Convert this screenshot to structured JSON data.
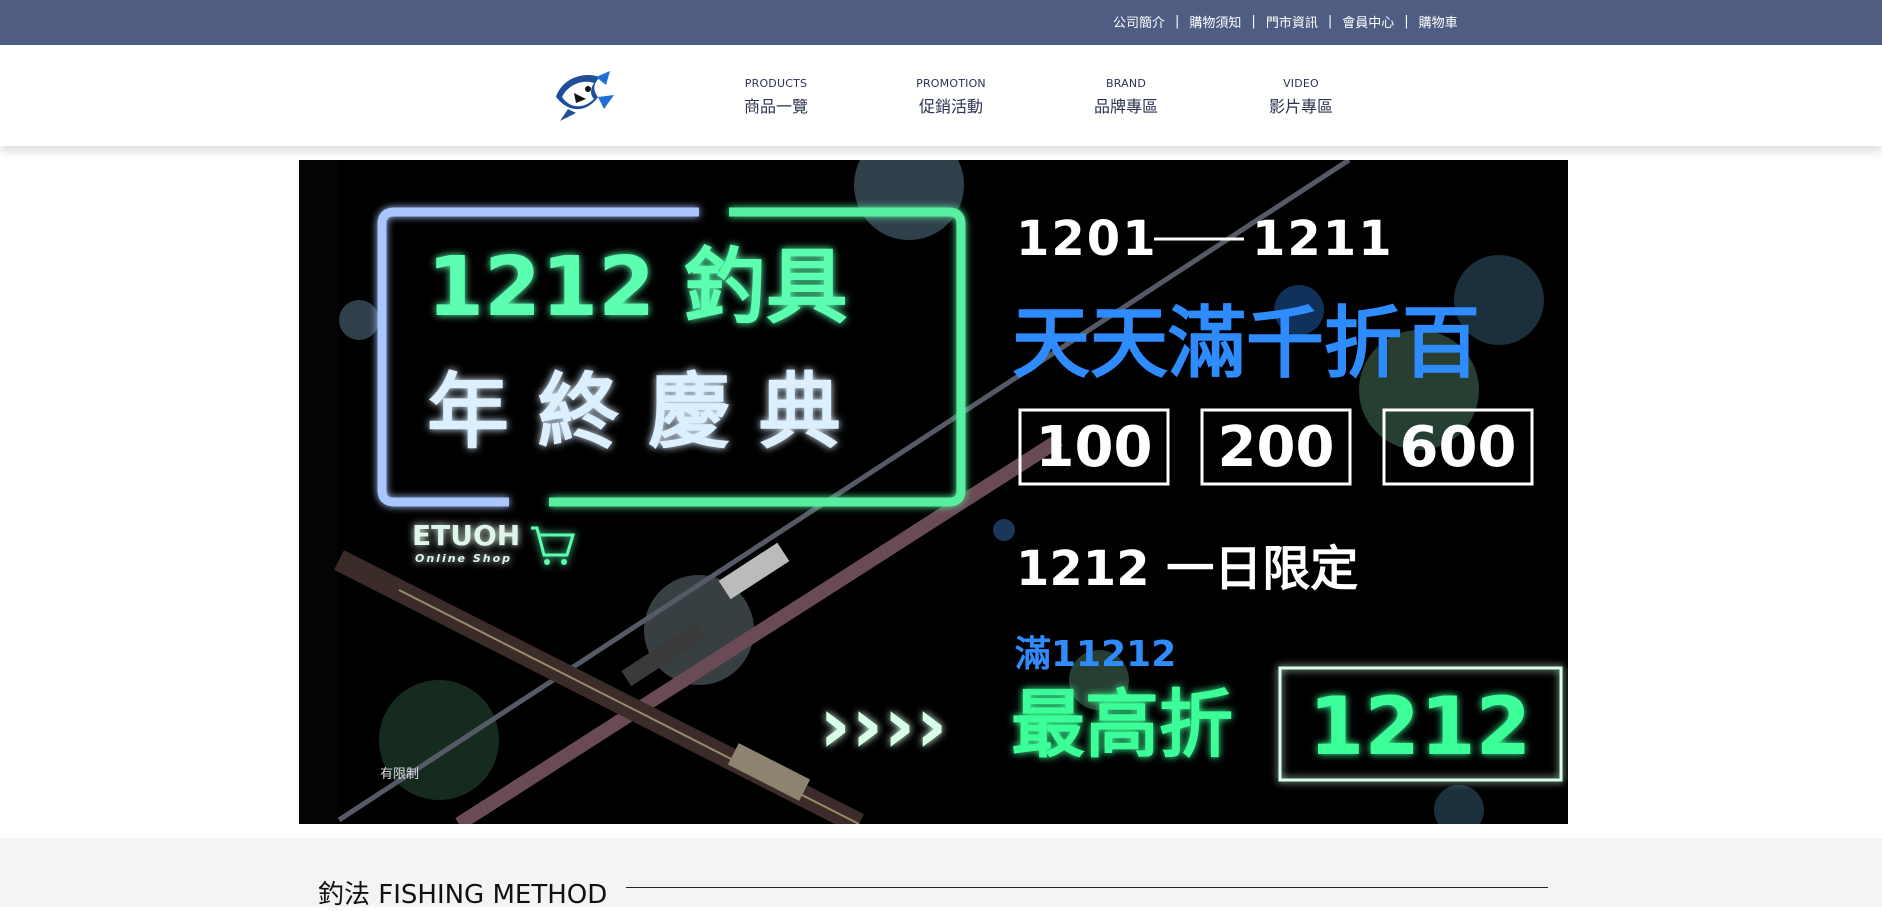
{
  "top_links": [
    "公司簡介",
    "購物須知",
    "門市資訊",
    "會員中心",
    "購物車"
  ],
  "top_separator": "|",
  "nav": [
    {
      "en": "PRODUCTS",
      "zh": "商品一覽"
    },
    {
      "en": "PROMOTION",
      "zh": "促銷活動"
    },
    {
      "en": "BRAND",
      "zh": "品牌專區"
    },
    {
      "en": "VIDEO",
      "zh": "影片專區"
    }
  ],
  "banner": {
    "headline_line1": "1212 釣具",
    "headline_line2": "年 終 慶 典",
    "date_range_start": "1201",
    "date_range_end": "1211",
    "daily_offer": "天天滿千折百",
    "discounts": [
      "100",
      "200",
      "600"
    ],
    "one_day_title": "1212 一日限定",
    "threshold": "滿11212",
    "max_discount_label": "最高折",
    "max_discount_value": "1212",
    "shop_name": "ETUOH",
    "shop_sub": "Online Shop",
    "disclaimer": "有限制",
    "arrows": "››››"
  },
  "section": {
    "title": "釣法 FISHING METHOD"
  },
  "colors": {
    "topbar": "#4f5d82",
    "nav_text": "#2b3350",
    "neon_green": "#3dff9a",
    "neon_blue": "#2f8cff"
  },
  "icons": {
    "logo": "fish-logo-icon",
    "cart": "cart-icon"
  }
}
